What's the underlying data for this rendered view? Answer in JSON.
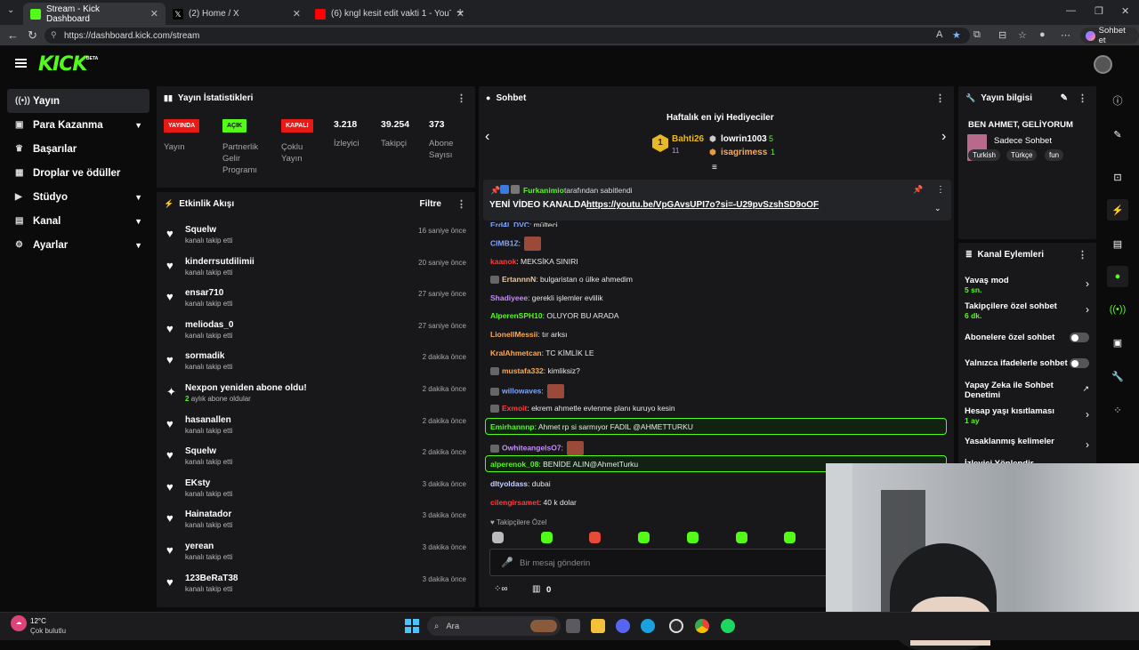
{
  "browser": {
    "tabs": [
      {
        "title": "Stream - Kick Dashboard",
        "active": true
      },
      {
        "title": "(2) Home / X",
        "active": false
      },
      {
        "title": "(6) kngl kesit edit vakti 1 - YouTube",
        "active": false
      }
    ],
    "url": "https://dashboard.kick.com/stream",
    "profile_button": "Sohbet et"
  },
  "app": {
    "logo": "KICK",
    "logo_sup": "BETA",
    "accent": "#53fc18"
  },
  "sidebar": {
    "items": [
      {
        "label": "Yayın",
        "icon": "broadcast-icon",
        "has_chevron": false,
        "active": true
      },
      {
        "label": "Para Kazanma",
        "icon": "money-icon",
        "has_chevron": true
      },
      {
        "label": "Başarılar",
        "icon": "trophy-icon",
        "has_chevron": false
      },
      {
        "label": "Droplar ve ödüller",
        "icon": "gift-icon",
        "has_chevron": false
      },
      {
        "label": "Stüdyo",
        "icon": "studio-icon",
        "has_chevron": true
      },
      {
        "label": "Kanal",
        "icon": "channel-icon",
        "has_chevron": true
      },
      {
        "label": "Ayarlar",
        "icon": "gear-icon",
        "has_chevron": true
      }
    ]
  },
  "stats": {
    "title": "Yayın İstatistikleri",
    "badges": [
      {
        "badge": "YAYINDA",
        "label": "Yayın",
        "color": "#e91916"
      },
      {
        "badge": "AÇIK",
        "label": "Partnerlik Gelir Programı",
        "color": "#53fc18"
      },
      {
        "badge": "KAPALI",
        "label": "Çoklu Yayın",
        "color": "#e91916"
      }
    ],
    "numbers": [
      {
        "value": "3.218",
        "label": "İzleyici"
      },
      {
        "value": "39.254",
        "label": "Takipçi"
      },
      {
        "value": "373",
        "label": "Abone Sayısı"
      }
    ]
  },
  "activity": {
    "title": "Etkinlik Akışı",
    "filter": "Filtre",
    "items": [
      {
        "name": "Squelw",
        "sub": "kanalı takip etti",
        "time": "16 saniye önce",
        "type": "follow"
      },
      {
        "name": "kinderrsutdilimii",
        "sub": "kanalı takip etti",
        "time": "20 saniye önce",
        "type": "follow"
      },
      {
        "name": "ensar710",
        "sub": "kanalı takip etti",
        "time": "27 saniye önce",
        "type": "follow"
      },
      {
        "name": "meliodas_0",
        "sub": "kanalı takip etti",
        "time": "27 saniye önce",
        "type": "follow"
      },
      {
        "name": "sormadik",
        "sub": "kanalı takip etti",
        "time": "2 dakika önce",
        "type": "follow"
      },
      {
        "name": "Nexpon yeniden abone oldu!",
        "sub_green": "2",
        "sub": "aylık abone oldular",
        "time": "2 dakika önce",
        "type": "sub"
      },
      {
        "name": "hasanallen",
        "sub": "kanalı takip etti",
        "time": "2 dakika önce",
        "type": "follow"
      },
      {
        "name": "Squelw",
        "sub": "kanalı takip etti",
        "time": "2 dakika önce",
        "type": "follow"
      },
      {
        "name": "EKsty",
        "sub": "kanalı takip etti",
        "time": "3 dakika önce",
        "type": "follow"
      },
      {
        "name": "Hainatador",
        "sub": "kanalı takip etti",
        "time": "3 dakika önce",
        "type": "follow"
      },
      {
        "name": "yerean",
        "sub": "kanalı takip etti",
        "time": "3 dakika önce",
        "type": "follow"
      },
      {
        "name": "123BeRaT38",
        "sub": "kanalı takip etti",
        "time": "3 dakika önce",
        "type": "follow"
      }
    ]
  },
  "chat": {
    "title": "Sohbet",
    "gifters_title": "Haftalık en iyi Hediyeciler",
    "gifters": [
      {
        "rank": "1",
        "name": "Bahti26",
        "count": "11"
      },
      {
        "name": "lowrin1003",
        "count": "5"
      },
      {
        "name": "isagrimess",
        "count": "1"
      }
    ],
    "pinned_by": "Furkanimio",
    "pinned_suffix": "tarafından sabitlendi",
    "pinned_text": "YENİ VİDEO KANALDA : ",
    "pinned_link": "https://youtu.be/VpGAvsUPI7o?si=-U29pvSzshSD9oOF",
    "messages": [
      {
        "user": "Erd4l_DVC",
        "text": "mülteci",
        "color": "#7fa7ff"
      },
      {
        "user": "CIMB1Z",
        "text": "",
        "color": "#7fa7ff",
        "emote": true
      },
      {
        "user": "kaanok",
        "text": "MEKSİKA SINIRI",
        "color": "#ff3b3b"
      },
      {
        "user": "ErtannnN",
        "text": "bulgaristan o ülke ahmedim",
        "color": "#e8c9a0",
        "badge": true
      },
      {
        "user": "Shadiyeee",
        "text": "gerekli işlemler evlilik",
        "color": "#c98bff"
      },
      {
        "user": "AlperenSPH10",
        "text": "OLUYOR BU ARADA",
        "color": "#53fc18"
      },
      {
        "user": "LionellMessii",
        "text": "tır arksı",
        "color": "#ffa94d"
      },
      {
        "user": "KralAhmetcan",
        "text": "TC KİMLİK LE",
        "color": "#ffa94d"
      },
      {
        "user": "mustafa332",
        "text": "kimliksiz?",
        "color": "#ffa94d",
        "badge": true
      },
      {
        "user": "willowaves",
        "text": "",
        "color": "#7fa7ff",
        "badge": true,
        "emote": true
      },
      {
        "user": "Exmoit",
        "text": "ekrem ahmetle evlenme planı kuruyo kesin",
        "color": "#ff3b3b",
        "badge": true
      },
      {
        "user": "Emirhannnp",
        "text": "Ahmet rp si sarmıyor FADIL @AHMETTURKU",
        "color": "#53fc18",
        "highlight": true
      },
      {
        "user": "OwhiteangelsO7",
        "text": "",
        "color": "#c98bff",
        "badge": true,
        "emote": true
      },
      {
        "user": "alperenok_08",
        "text": "BENİDE ALIN@AhmetTurku",
        "color": "#53fc18",
        "highlight": true
      },
      {
        "user": "dltyoldass",
        "text": "dubai",
        "color": "#c8d0ff"
      },
      {
        "user": "cilengirsamet",
        "text": "40 k dolar",
        "color": "#ff3b3b"
      }
    ],
    "followers_only": "Takipçilere Özel",
    "input_placeholder": "Bir mesaj gönderin",
    "footer_count": "0"
  },
  "stream_info": {
    "title": "Yayın bilgisi",
    "stream_title": "BEN AHMET, GELİYORUM",
    "category": "Sadece Sohbet",
    "tags": [
      "Turkish",
      "Türkçe",
      "fun"
    ]
  },
  "channel_actions": {
    "title": "Kanal Eylemleri",
    "items": [
      {
        "label": "Yavaş mod",
        "value": "5 sn.",
        "control": "chevron"
      },
      {
        "label": "Takipçilere özel sohbet",
        "value": "6 dk.",
        "control": "chevron"
      },
      {
        "label": "Abonelere özel sohbet",
        "value": "",
        "control": "toggle"
      },
      {
        "label": "Yalnızca ifadelerle sohbet",
        "value": "",
        "control": "toggle"
      },
      {
        "label": "Yapay Zeka ile Sohbet Denetimi",
        "value": "",
        "control": "external"
      },
      {
        "label": "Hesap yaşı kısıtlaması",
        "value": "1 ay",
        "control": "chevron"
      },
      {
        "label": "Yasaklanmış kelimeler",
        "value": "",
        "control": "chevron"
      },
      {
        "label": "İzleyici Yönlendir",
        "value": "",
        "control": "chevron"
      }
    ]
  },
  "taskbar": {
    "weather_temp": "12°C",
    "weather_desc": "Çok bulutlu",
    "search_placeholder": "Ara"
  }
}
